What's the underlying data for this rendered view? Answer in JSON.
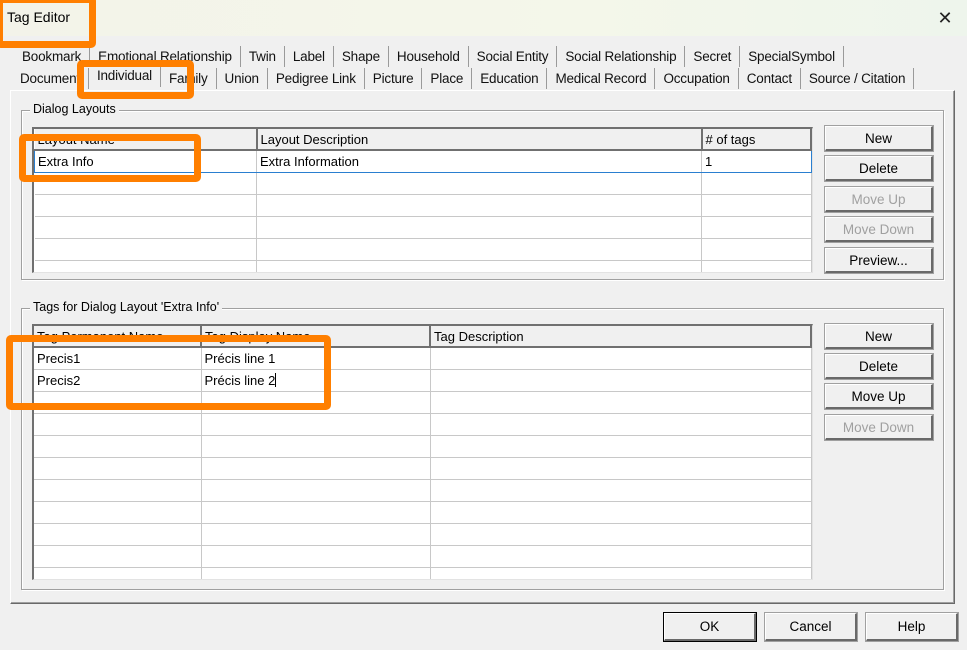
{
  "window": {
    "title": "Tag Editor",
    "close_icon": "close-icon"
  },
  "tabs": {
    "row1": [
      "Bookmark",
      "Emotional Relationship",
      "Twin",
      "Label",
      "Shape",
      "Household",
      "Social Entity",
      "Social Relationship",
      "Secret",
      "SpecialSymbol"
    ],
    "row2": [
      "Document",
      "Individual",
      "Family",
      "Union",
      "Pedigree Link",
      "Picture",
      "Place",
      "Education",
      "Medical Record",
      "Occupation",
      "Contact",
      "Source / Citation"
    ],
    "active": "Individual"
  },
  "dialog_layouts": {
    "group_label": "Dialog Layouts",
    "columns": [
      "Layout Name",
      "Layout Description",
      "# of tags"
    ],
    "rows": [
      [
        "Extra Info",
        "Extra Information",
        "1"
      ],
      [
        "",
        "",
        ""
      ],
      [
        "",
        "",
        ""
      ],
      [
        "",
        "",
        ""
      ],
      [
        "",
        "",
        ""
      ],
      [
        "",
        "",
        ""
      ]
    ],
    "selected_row": 0,
    "buttons": [
      {
        "label": "New",
        "enabled": true
      },
      {
        "label": "Delete",
        "enabled": true
      },
      {
        "label": "Move Up",
        "enabled": false
      },
      {
        "label": "Move Down",
        "enabled": false
      },
      {
        "label": "Preview...",
        "enabled": true
      }
    ]
  },
  "tags": {
    "group_label": "Tags for Dialog Layout 'Extra Info'",
    "columns": [
      "Tag Permanent Name",
      "Tag Display Name",
      "Tag Description"
    ],
    "rows": [
      [
        "Precis1",
        "Précis line 1",
        ""
      ],
      [
        "Precis2",
        "Précis line 2",
        ""
      ],
      [
        "",
        "",
        ""
      ],
      [
        "",
        "",
        ""
      ],
      [
        "",
        "",
        ""
      ],
      [
        "",
        "",
        ""
      ],
      [
        "",
        "",
        ""
      ],
      [
        "",
        "",
        ""
      ],
      [
        "",
        "",
        ""
      ],
      [
        "",
        "",
        ""
      ],
      [
        "",
        "",
        ""
      ]
    ],
    "buttons": [
      {
        "label": "New",
        "enabled": true
      },
      {
        "label": "Delete",
        "enabled": true
      },
      {
        "label": "Move Up",
        "enabled": true
      },
      {
        "label": "Move Down",
        "enabled": false
      }
    ]
  },
  "footer": {
    "ok_label": "OK",
    "cancel_label": "Cancel",
    "help_label": "Help"
  },
  "annotation_color": "#ff7f00"
}
